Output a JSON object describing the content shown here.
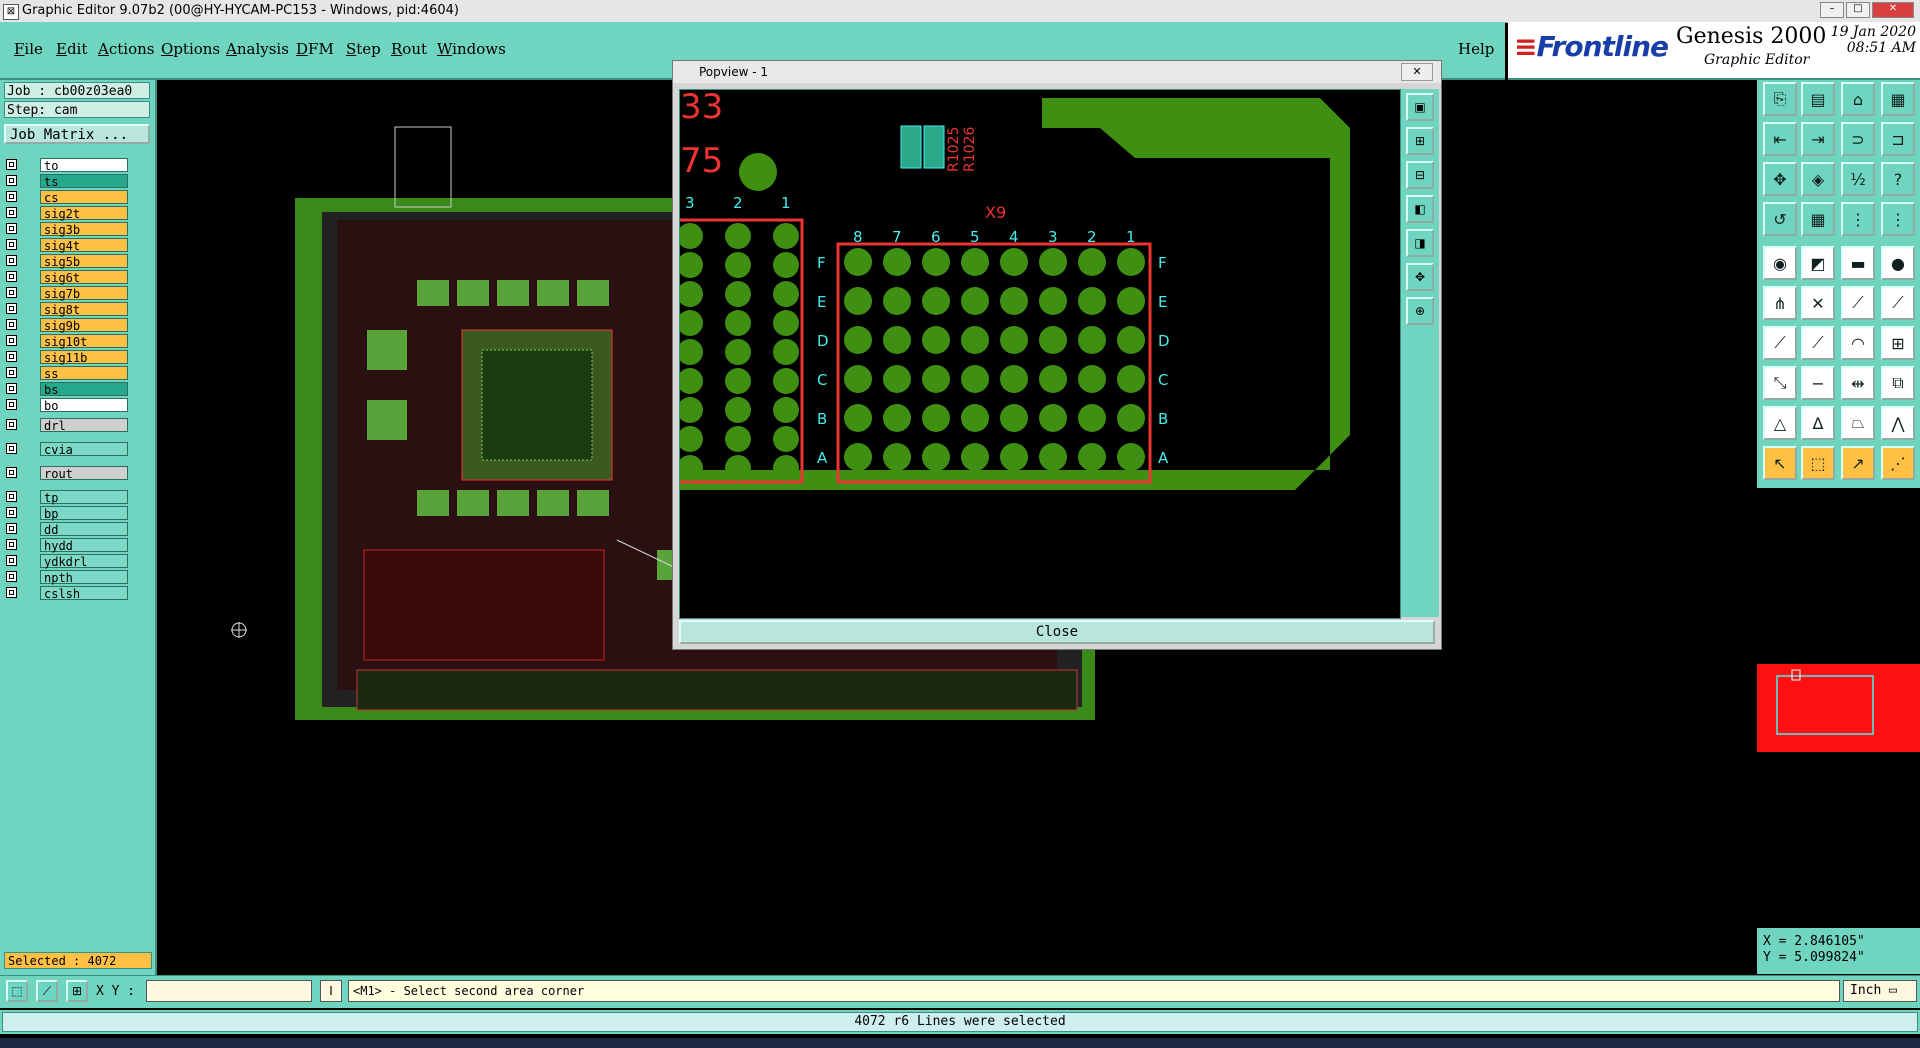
{
  "window": {
    "title": "Graphic Editor 9.07b2 (00@HY-HYCAM-PC153 - Windows, pid:4604)"
  },
  "menu": {
    "items": [
      "File",
      "Edit",
      "Actions",
      "Options",
      "Analysis",
      "DFM",
      "Step",
      "Rout",
      "Windows"
    ],
    "help": "Help"
  },
  "brand": {
    "logo": "Frontline",
    "product": "Genesis 2000",
    "subtitle": "Graphic Editor",
    "date": "19 Jan 2020",
    "time": "08:51 AM"
  },
  "job": {
    "job_line": "Job : cb00z03ea0",
    "step_line": "Step: cam",
    "matrix_button": "Job Matrix ..."
  },
  "layers": [
    {
      "name": "to",
      "color": "white"
    },
    {
      "name": "ts",
      "color": "teal"
    },
    {
      "name": "cs",
      "color": "orange"
    },
    {
      "name": "sig2t",
      "color": "orange"
    },
    {
      "name": "sig3b",
      "color": "orange"
    },
    {
      "name": "sig4t",
      "color": "orange"
    },
    {
      "name": "sig5b",
      "color": "orange"
    },
    {
      "name": "sig6t",
      "color": "orange"
    },
    {
      "name": "sig7b",
      "color": "orange"
    },
    {
      "name": "sig8t",
      "color": "orange"
    },
    {
      "name": "sig9b",
      "color": "orange"
    },
    {
      "name": "sig10t",
      "color": "orange"
    },
    {
      "name": "sig11b",
      "color": "orange"
    },
    {
      "name": "ss",
      "color": "orange"
    },
    {
      "name": "bs",
      "color": "teal"
    },
    {
      "name": "bo",
      "color": "white"
    },
    {
      "name": "drl",
      "color": "grey"
    },
    {
      "name": "cvia",
      "color": "ltteal"
    },
    {
      "name": "rout",
      "color": "grey"
    },
    {
      "name": "tp",
      "color": "ltteal"
    },
    {
      "name": "bp",
      "color": "ltteal"
    },
    {
      "name": "dd",
      "color": "ltteal"
    },
    {
      "name": "hydd",
      "color": "ltteal"
    },
    {
      "name": "ydkdrl",
      "color": "ltteal"
    },
    {
      "name": "npth",
      "color": "ltteal"
    },
    {
      "name": "cslsh",
      "color": "ltteal"
    }
  ],
  "selected_count": "Selected : 4072",
  "command": {
    "xy_label": "X Y :",
    "xy_value": "",
    "prompt": "<M1> - Select second area corner",
    "units": "Inch"
  },
  "status": "4072 r6 Lines were selected",
  "coords": {
    "x": "X = 2.846105\"",
    "y": "Y = 5.099824\""
  },
  "popview": {
    "title": "Popview - 1",
    "close_label": "Close",
    "component": "X9",
    "refs": [
      "R1025",
      "R1026"
    ],
    "big_labels": [
      "33",
      "75"
    ],
    "col_labels_left": [
      "3",
      "2",
      "1"
    ],
    "col_labels_right": [
      "8",
      "7",
      "6",
      "5",
      "4",
      "3",
      "2",
      "1"
    ],
    "row_labels": [
      "F",
      "E",
      "D",
      "C",
      "B",
      "A"
    ]
  }
}
